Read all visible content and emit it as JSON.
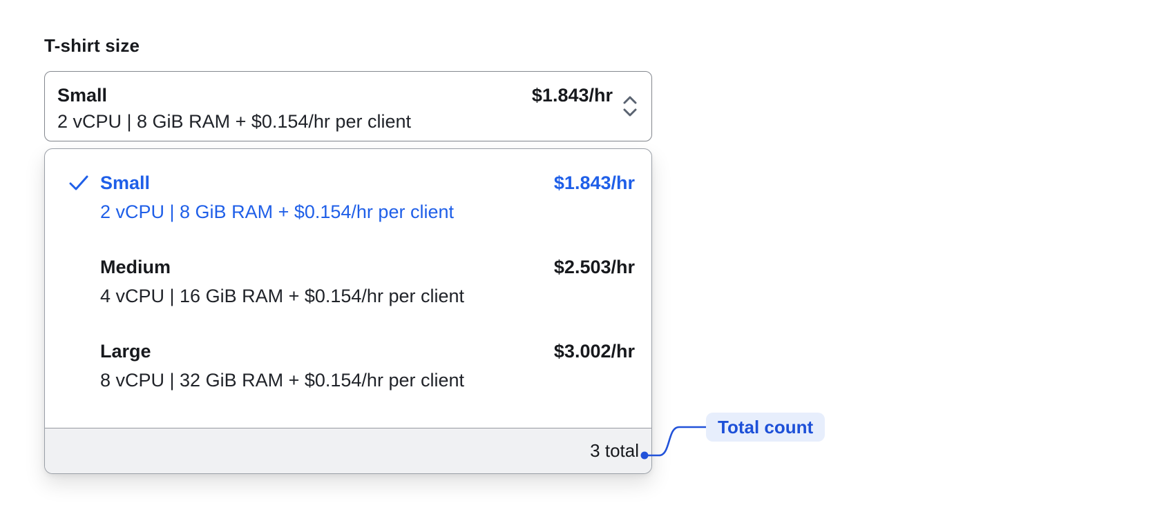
{
  "field": {
    "label": "T-shirt size"
  },
  "trigger": {
    "selected_name": "Small",
    "selected_specs": "2 vCPU | 8 GiB RAM + $0.154/hr per client",
    "selected_price": "$1.843/hr",
    "chevron_icon": "chevron-up-down-icon"
  },
  "dropdown": {
    "options": [
      {
        "name": "Small",
        "specs": "2 vCPU | 8 GiB RAM + $0.154/hr per client",
        "price": "$1.843/hr",
        "selected": true,
        "check_icon": "checkmark-icon"
      },
      {
        "name": "Medium",
        "specs": "4 vCPU | 16 GiB RAM + $0.154/hr per client",
        "price": "$2.503/hr",
        "selected": false
      },
      {
        "name": "Large",
        "specs": "8 vCPU | 32 GiB RAM + $0.154/hr per client",
        "price": "$3.002/hr",
        "selected": false
      }
    ],
    "footer": {
      "total": "3 total"
    }
  },
  "annotation": {
    "label": "Total count",
    "target": "3 total"
  },
  "colors": {
    "selected_blue": "#1f5fe8",
    "annotation_blue": "#2152d9",
    "pill_background": "#e7eefc",
    "pill_text": "#1d50d8",
    "footer_background": "#f0f1f3",
    "trigger_border": "#84888f",
    "panel_border": "#999ea6",
    "text_primary": "#17191d"
  }
}
